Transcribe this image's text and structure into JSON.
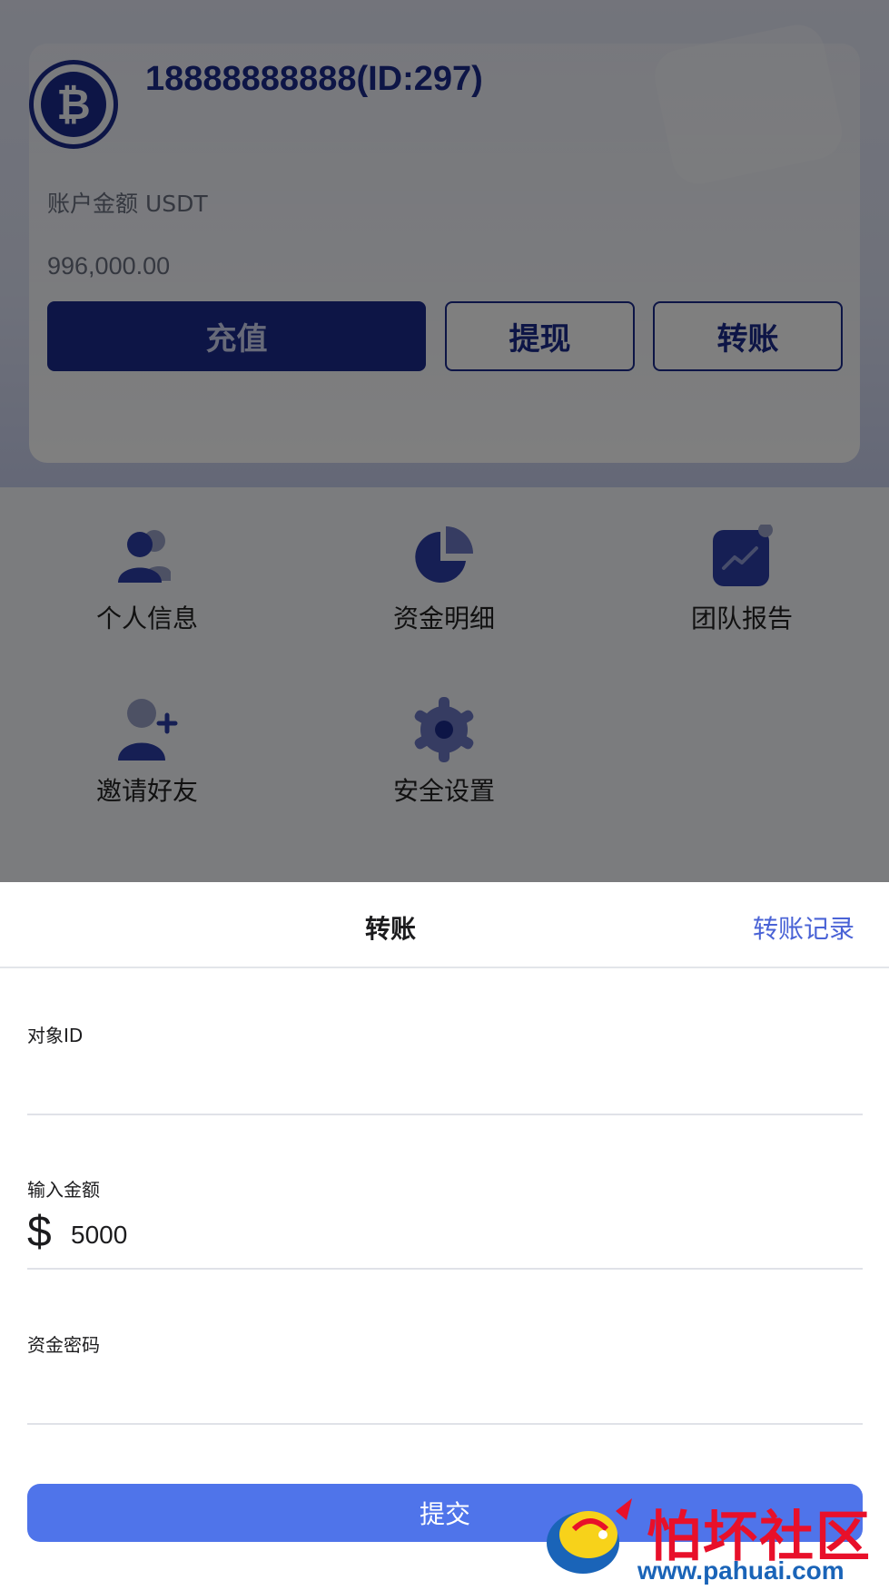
{
  "account": {
    "user_line": "18888888888(ID:297)",
    "balance_label": "账户金额 USDT",
    "balance_value": "996,000.00",
    "avatar_icon": "bitcoin-icon"
  },
  "actions": {
    "recharge": "充值",
    "withdraw": "提现",
    "transfer": "转账"
  },
  "menu": {
    "items": [
      {
        "label": "个人信息",
        "icon": "user-group-icon"
      },
      {
        "label": "资金明细",
        "icon": "pie-chart-icon"
      },
      {
        "label": "团队报告",
        "icon": "trend-chart-icon"
      },
      {
        "label": "邀请好友",
        "icon": "add-user-icon"
      },
      {
        "label": "安全设置",
        "icon": "gear-icon"
      }
    ]
  },
  "sheet": {
    "title": "转账",
    "history_link": "转账记录",
    "target_label": "对象ID",
    "target_value": "",
    "amount_label": "输入金额",
    "currency_symbol": "$",
    "amount_value": "5000",
    "password_label": "资金密码",
    "password_value": "",
    "submit": "提交"
  },
  "watermark": {
    "text": "怕坏社区",
    "url": "www.pahuai.com"
  },
  "colors": {
    "primary": "#1b2a8c",
    "accent": "#4f74ea",
    "link": "#4a63d6",
    "watermark_red": "#e8102a"
  }
}
